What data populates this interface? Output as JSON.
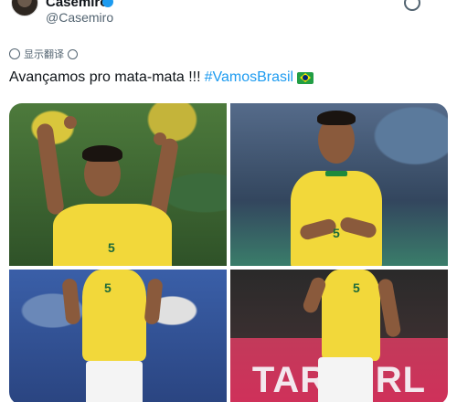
{
  "user": {
    "display_name": "Casemiro",
    "handle": "@Casemiro",
    "verified": true
  },
  "translate": {
    "label": "显示翻译"
  },
  "tweet": {
    "text": "Avançamos pro mata-mata !!!",
    "hashtag": "#VamosBrasil",
    "emoji": "brazil-flag"
  },
  "media": {
    "photos": [
      {
        "subject": "celebrating-fists",
        "shirt_number": "5"
      },
      {
        "subject": "smiling-clapping",
        "shirt_number": "5"
      },
      {
        "subject": "walking-clapping",
        "shirt_number": "5"
      },
      {
        "subject": "running-celebration",
        "shirt_number": "5",
        "board_text": "TAR AIRL"
      }
    ]
  },
  "colors": {
    "link": "#1d9bf0",
    "text": "#0f1419",
    "secondary": "#536471",
    "jersey": "#f2d83a"
  }
}
